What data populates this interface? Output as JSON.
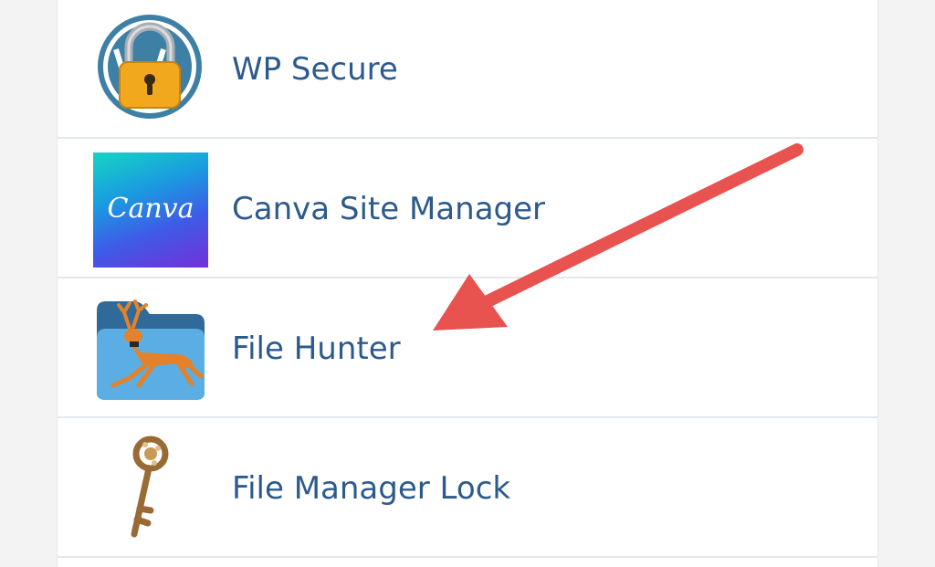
{
  "plugins": [
    {
      "label": "WP Secure",
      "icon": "wp-padlock-icon"
    },
    {
      "label": "Canva Site Manager",
      "icon": "canva-logo-icon",
      "logo_text": "Canva"
    },
    {
      "label": "File Hunter",
      "icon": "folder-deer-icon"
    },
    {
      "label": "File Manager Lock",
      "icon": "skeleton-key-icon"
    }
  ],
  "annotation": {
    "type": "arrow",
    "color": "#e8524f",
    "points_to": "File Hunter"
  },
  "colors": {
    "label": "#2c5a8c",
    "divider": "#e4e8ee",
    "background": "#f3f3f4",
    "panel": "#ffffff"
  }
}
